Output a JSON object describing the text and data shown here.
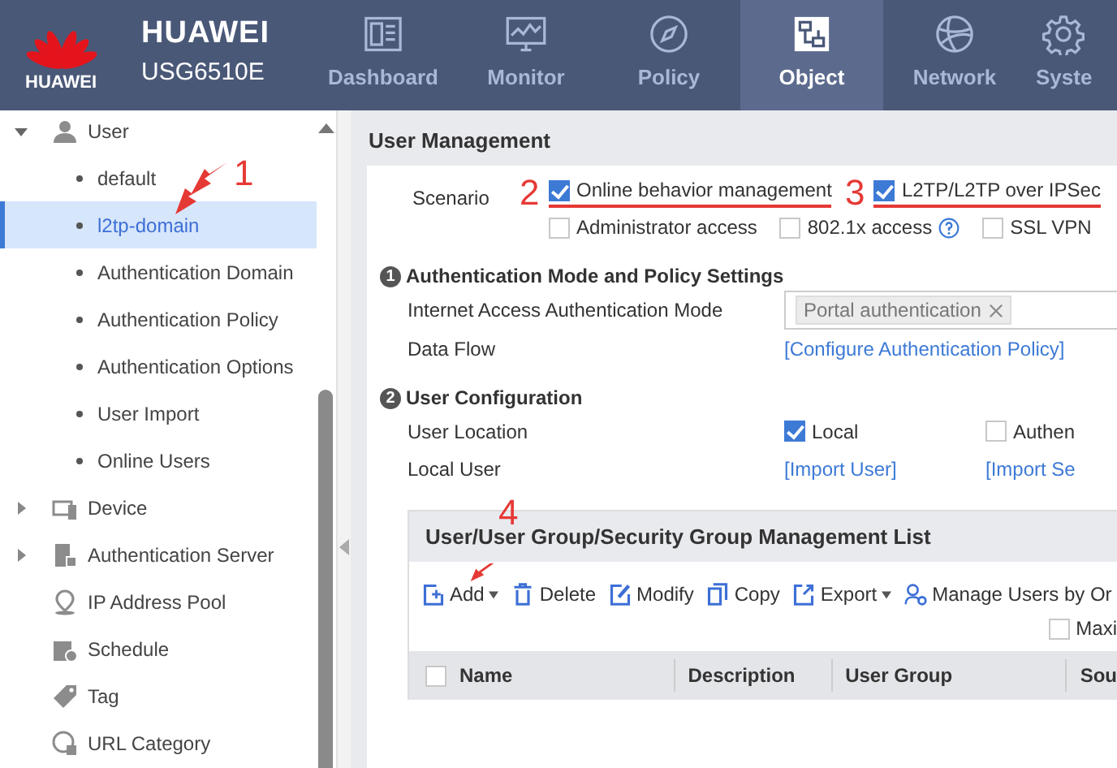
{
  "header": {
    "logo_text": "HUAWEI",
    "brand": "HUAWEI",
    "model": "USG6510E",
    "nav": [
      {
        "label": "Dashboard",
        "selected": false
      },
      {
        "label": "Monitor",
        "selected": false
      },
      {
        "label": "Policy",
        "selected": false
      },
      {
        "label": "Object",
        "selected": true
      },
      {
        "label": "Network",
        "selected": false
      },
      {
        "label": "Syste",
        "selected": false
      }
    ]
  },
  "sidebar": {
    "tree": [
      {
        "label": "User",
        "kind": "folder",
        "expanded": true,
        "children": [
          {
            "label": "default",
            "selected": false
          },
          {
            "label": "l2tp-domain",
            "selected": true
          },
          {
            "label": "Authentication Domain",
            "selected": false
          },
          {
            "label": "Authentication Policy",
            "selected": false
          },
          {
            "label": "Authentication Options",
            "selected": false
          },
          {
            "label": "User Import",
            "selected": false
          },
          {
            "label": "Online Users",
            "selected": false
          }
        ]
      },
      {
        "label": "Device",
        "kind": "folder",
        "expanded": false
      },
      {
        "label": "Authentication Server",
        "kind": "folder",
        "expanded": false
      },
      {
        "label": "IP Address Pool",
        "kind": "item"
      },
      {
        "label": "Schedule",
        "kind": "item"
      },
      {
        "label": "Tag",
        "kind": "item"
      },
      {
        "label": "URL Category",
        "kind": "item"
      }
    ]
  },
  "page_title": "User Management",
  "scenario": {
    "label": "Scenario",
    "rows": [
      [
        {
          "label": "Online behavior management",
          "checked": true,
          "marker": "2",
          "underlined": true
        },
        {
          "label": "L2TP/L2TP over IPSec",
          "checked": true,
          "marker": "3",
          "underlined": true
        }
      ],
      [
        {
          "label": "Administrator access",
          "checked": false
        },
        {
          "label": "802.1x access",
          "checked": false,
          "help": true
        },
        {
          "label": "SSL VPN",
          "checked": false
        }
      ]
    ]
  },
  "sections": [
    {
      "number": "1",
      "title": "Authentication Mode and Policy Settings",
      "fields": [
        {
          "label": "Internet Access Authentication Mode",
          "kind": "tags",
          "tags": [
            "Portal authentication"
          ]
        },
        {
          "label": "Data Flow",
          "kind": "links",
          "links": [
            "[Configure Authentication Policy]"
          ]
        }
      ]
    },
    {
      "number": "2",
      "title": "User Configuration",
      "fields": [
        {
          "label": "User Location",
          "kind": "checks",
          "options": [
            {
              "label": "Local",
              "checked": true
            },
            {
              "label": "Authen",
              "checked": false
            }
          ]
        },
        {
          "label": "Local User",
          "kind": "links",
          "links": [
            "[Import User]",
            "[Import Se"
          ]
        }
      ]
    }
  ],
  "list": {
    "title": "User/User Group/Security Group Management List",
    "marker": "4",
    "toolbar": [
      {
        "label": "Add",
        "dropdown": true
      },
      {
        "label": "Delete"
      },
      {
        "label": "Modify"
      },
      {
        "label": "Copy"
      },
      {
        "label": "Export",
        "dropdown": true
      },
      {
        "label": "Manage Users by Or"
      }
    ],
    "option": {
      "label": "Maxi",
      "checked": false
    },
    "select_all": false,
    "columns": [
      "Name",
      "Description",
      "User Group",
      "Sou"
    ]
  },
  "annotations": [
    {
      "text": "1"
    }
  ]
}
